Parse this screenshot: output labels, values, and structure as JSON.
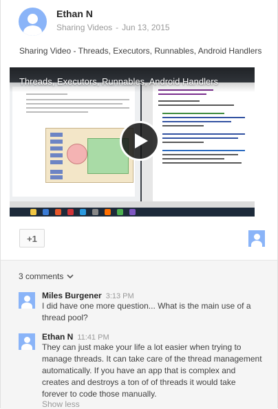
{
  "post": {
    "author": "Ethan N",
    "share_type": "Sharing Videos",
    "separator": "-",
    "date": "Jun 13, 2015",
    "text": "Sharing Video - Threads, Executors, Runnables, Android Handlers"
  },
  "video": {
    "title": "Threads, Executors, Runnables, Android Handlers"
  },
  "actions": {
    "plus_one_label": "+1"
  },
  "comments": {
    "count_label": "3 comments",
    "items": [
      {
        "author": "Miles Burgener",
        "time": "3:13 PM",
        "text": "I did have one more question... What is the main use of a thread pool?"
      },
      {
        "author": "Ethan N",
        "time": "11:41 PM",
        "text": "They can just make your life a lot easier when trying to manage threads. It can take care of the thread management automatically. If you have an app that is complex and creates and destroys a ton of of threads it would take forever to code those manually."
      }
    ],
    "show_less_label": "Show less"
  },
  "icons": {
    "avatar": "default-user-avatar-icon",
    "play": "play-icon",
    "chevron": "chevron-down-icon"
  },
  "colors": {
    "avatar_bg": "#8ab4f8",
    "muted_text": "#999999",
    "comments_bg": "#f5f5f5"
  }
}
